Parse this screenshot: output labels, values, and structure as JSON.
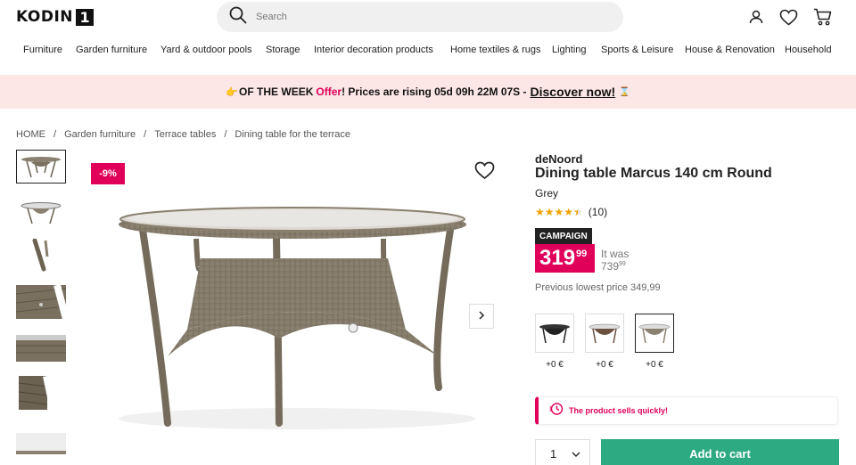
{
  "header": {
    "logo_text": "KODIN",
    "logo_number": "1",
    "search_placeholder": "Search",
    "icons": [
      "user-icon",
      "heart-icon",
      "cart-icon"
    ]
  },
  "nav": {
    "items": [
      "Furniture",
      "Garden furniture",
      "Yard & outdoor pools",
      "Storage",
      "Interior decoration products",
      "Home textiles & rugs",
      "Lighting",
      "Sports & Leisure",
      "House & Renovation",
      "Household"
    ]
  },
  "banner": {
    "of_the_week": "OF THE WEEK",
    "offer": "Offer",
    "countdown_text": "! Prices are rising 05d 09h 22M 07S -",
    "cta": "Discover now!",
    "bg_color": "#fce6e6",
    "accent": "#e0005a"
  },
  "breadcrumb": {
    "items": [
      "HOME",
      "Garden furniture",
      "Terrace tables",
      "Dining table for the terrace"
    ],
    "separator": "/"
  },
  "gallery": {
    "discount_badge": "-9%",
    "thumbnail_count": 7
  },
  "product": {
    "brand": "deNoord",
    "title": "Dining table Marcus 140 cm Round",
    "color": "Grey",
    "rating_stars": 4.5,
    "review_count": "(10)",
    "campaign_label": "CAMPAIGN",
    "price_main": "319",
    "price_cents": "99",
    "it_was_label": "It was",
    "it_was_price": "739",
    "it_was_cents": "99",
    "previous_lowest": "Previous lowest price 349,99",
    "variants": [
      {
        "price": "+0 €"
      },
      {
        "price": "+0 €"
      },
      {
        "price": "+0 €"
      }
    ],
    "alert_text": "The product sells quickly!",
    "quantity": "1",
    "add_to_cart": "Add to cart",
    "cta_color": "#2eaa82"
  }
}
